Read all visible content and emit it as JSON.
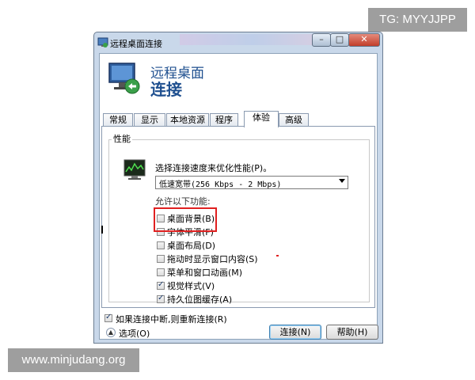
{
  "overlay": {
    "tg_text": "TG: MYYJJPP",
    "watermark_text": "www.minjudang.org"
  },
  "window": {
    "title": "远程桌面连接",
    "controls": {
      "minimize": "–",
      "maximize": "□",
      "close": "✕"
    }
  },
  "banner": {
    "line1": "远程桌面",
    "line2": "连接",
    "icon": "remote-desktop-monitor-icon"
  },
  "tabs": [
    {
      "label": "常规"
    },
    {
      "label": "显示"
    },
    {
      "label": "本地资源"
    },
    {
      "label": "程序"
    },
    {
      "label": "体验",
      "active": true
    },
    {
      "label": "高级"
    }
  ],
  "performance": {
    "group_label": "性能",
    "speed_label": "选择连接速度来优化性能(P)。",
    "speed_value": "低速宽带(256 Kbps - 2 Mbps)",
    "allow_label": "允许以下功能:",
    "options": [
      {
        "label": "桌面背景(B)",
        "checked": false
      },
      {
        "label": "字体平滑(F)",
        "checked": false
      },
      {
        "label": "桌面布局(D)",
        "checked": false
      },
      {
        "label": "拖动时显示窗口内容(S)",
        "checked": false
      },
      {
        "label": "菜单和窗口动画(M)",
        "checked": false
      },
      {
        "label": "视觉样式(V)",
        "checked": true
      },
      {
        "label": "持久位图缓存(A)",
        "checked": true
      }
    ]
  },
  "reconnect": {
    "label": "如果连接中断,则重新连接(R)",
    "checked": true
  },
  "bottom": {
    "options_label": "选项(O)",
    "connect_label": "连接(N)",
    "help_label": "帮助(H)"
  },
  "colors": {
    "accent": "#1e4f8f",
    "highlight": "#e02020",
    "window_frame": "#c9d8ea"
  }
}
